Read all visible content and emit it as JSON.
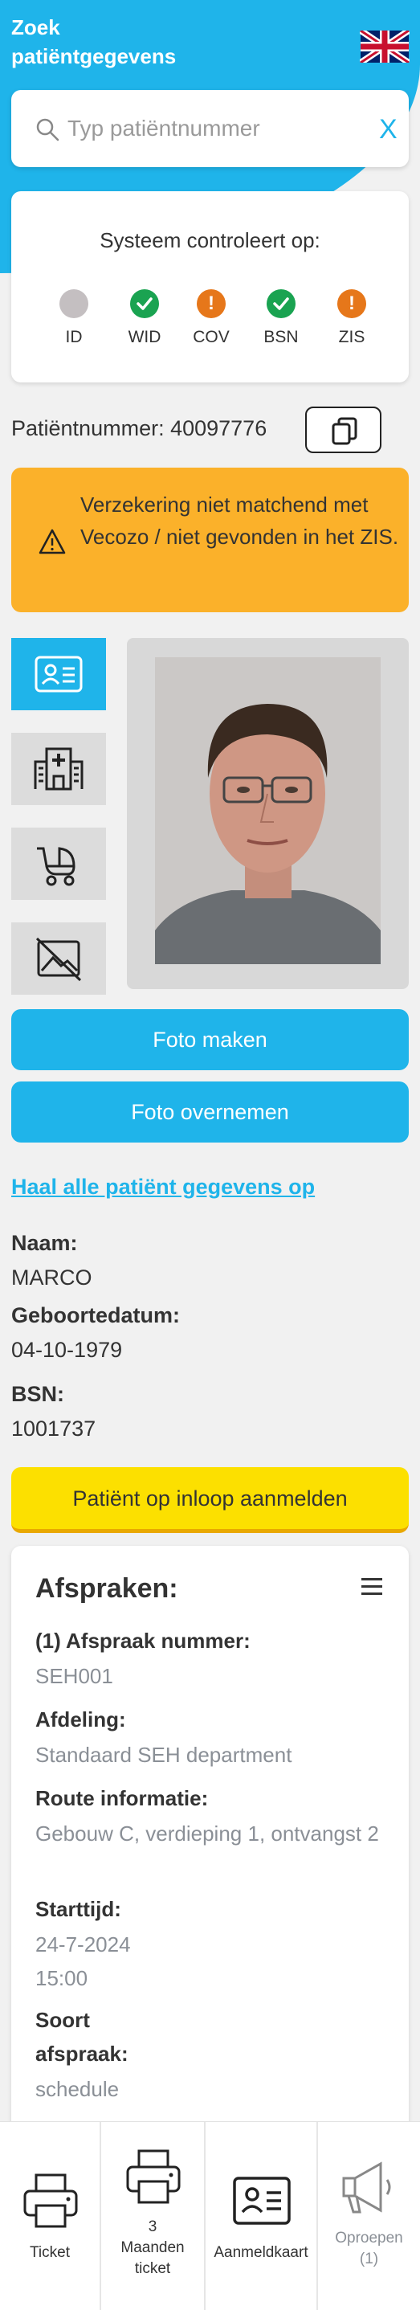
{
  "header": {
    "title": "Zoek patiëntgegevens",
    "language_icon": "uk-flag-icon"
  },
  "search": {
    "placeholder": "Typ patiëntnummer",
    "clear_label": "X"
  },
  "system_check": {
    "heading": "Systeem controleert op:",
    "items": [
      {
        "label": "ID",
        "status": "unknown",
        "color": "#c4bfc1"
      },
      {
        "label": "WID",
        "status": "ok",
        "color": "#1aa351"
      },
      {
        "label": "COV",
        "status": "warning",
        "color": "#e6771a"
      },
      {
        "label": "BSN",
        "status": "ok",
        "color": "#1aa351"
      },
      {
        "label": "ZIS",
        "status": "warning",
        "color": "#e6771a"
      }
    ]
  },
  "patient": {
    "number_text": "Patiëntnummer: 40097776",
    "warning": "Verzekering niet matchend met Vecozo / niet gevonden in het ZIS."
  },
  "side_tabs": [
    "id-card-icon",
    "hospital-icon",
    "stroller-icon",
    "no-image-icon"
  ],
  "buttons": {
    "take_photo": "Foto maken",
    "copy_photo": "Foto overnemen",
    "fetch_all": "Haal alle patiënt gegevens op",
    "register": "Patiënt op inloop aanmelden"
  },
  "details": {
    "name_label": "Naam:",
    "name_value": "MARCO",
    "dob_label": "Geboortedatum:",
    "dob_value": "04-10-1979",
    "bsn_label": "BSN:",
    "bsn_value": "1001737"
  },
  "appointments": {
    "heading": "Afspraken:",
    "number_label": "(1) Afspraak nummer:",
    "number_value": "SEH001",
    "dept_label": "Afdeling:",
    "dept_value": "Standaard SEH department",
    "route_label": "Route informatie:",
    "route_value": "Gebouw C, verdieping 1, ontvangst 2",
    "start_label": "Starttijd:",
    "start_date": "24-7-2024",
    "start_time": "15:00",
    "type_label_1": "Soort",
    "type_label_2": "afspraak:",
    "type_value": "schedule"
  },
  "footer": {
    "ticket": "Ticket",
    "three_month_1": "3",
    "three_month_2": "Maanden",
    "three_month_3": "ticket",
    "card": "Aanmeldkaart",
    "call_1": "Oproepen",
    "call_2": "(1)"
  },
  "colors": {
    "primary": "#1fb4ea",
    "warning": "#fbb12a",
    "register": "#fce000"
  }
}
